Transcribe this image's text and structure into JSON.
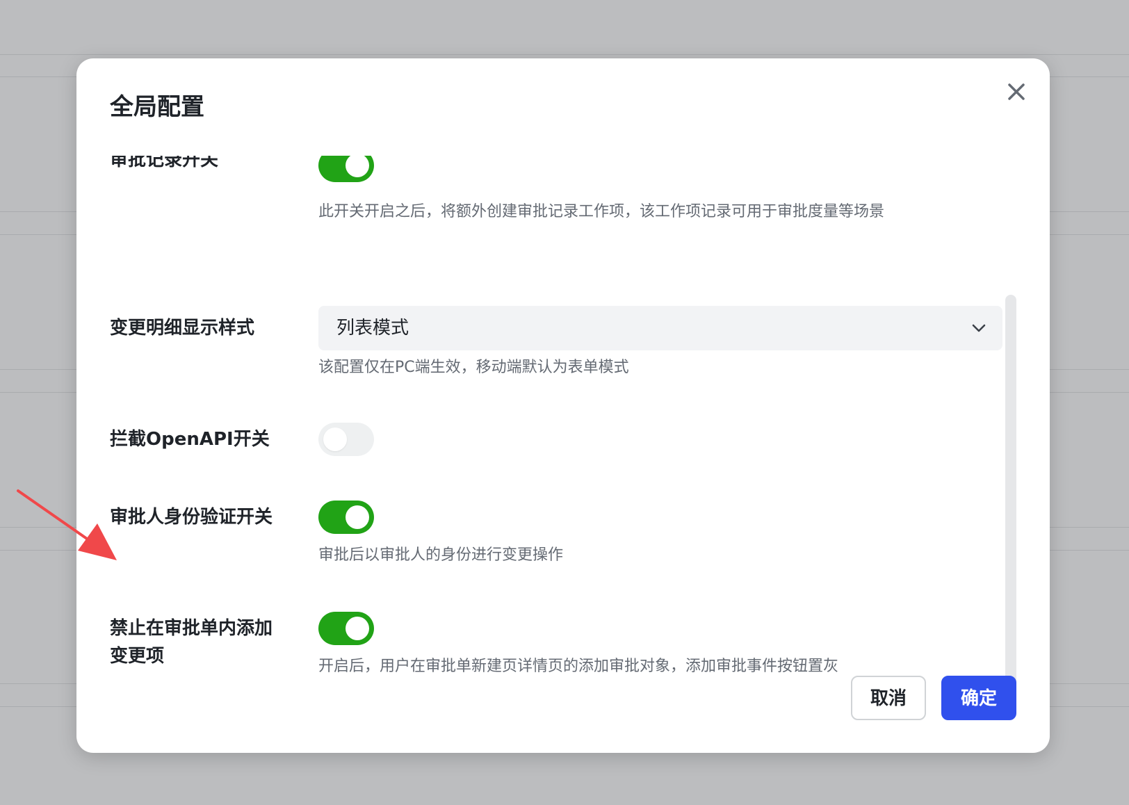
{
  "modal": {
    "title": "全局配置",
    "close_icon": "close-icon"
  },
  "settings": [
    {
      "label": "审批记录开关",
      "control": "toggle",
      "checked": true,
      "description": "此开关开启之后，将额外创建审批记录工作项，该工作项记录可用于审批度量等场景"
    },
    {
      "label": "变更明细显示样式",
      "control": "select",
      "value": "列表模式",
      "description": "该配置仅在PC端生效，移动端默认为表单模式"
    },
    {
      "label": "拦截OpenAPI开关",
      "control": "toggle",
      "checked": false
    },
    {
      "label": "审批人身份验证开关",
      "control": "toggle",
      "checked": true,
      "description": "审批后以审批人的身份进行变更操作"
    },
    {
      "label_line1": "禁止在审批单内添加",
      "label_line2": "变更项",
      "control": "toggle",
      "checked": true,
      "description": "开启后，用户在审批单新建页详情页的添加审批对象，添加审批事件按钮置灰"
    }
  ],
  "footer": {
    "cancel_label": "取消",
    "confirm_label": "确定"
  },
  "colors": {
    "toggle_on": "#21a316",
    "toggle_off": "#eef0f1",
    "primary": "#3050ed",
    "annotation_arrow": "#f0484a"
  }
}
